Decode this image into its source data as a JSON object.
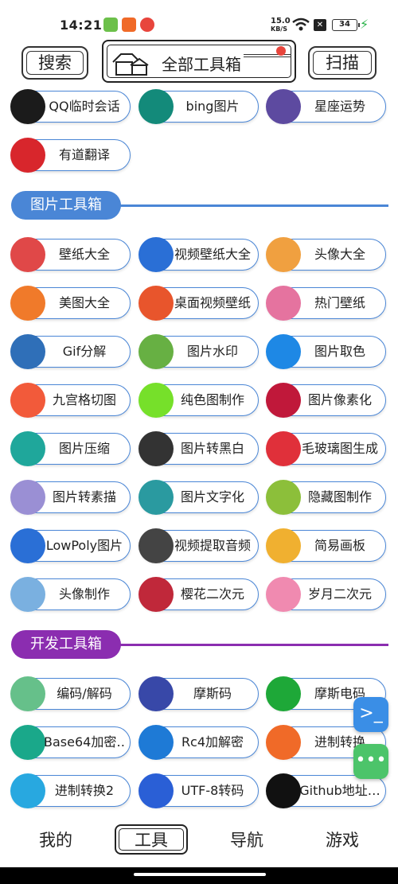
{
  "status": {
    "time": "14:21",
    "net_speed": "15.0",
    "net_unit": "KB/S",
    "battery": "34"
  },
  "header": {
    "search": "搜索",
    "title": "全部工具箱",
    "scan": "扫描"
  },
  "top_items": [
    {
      "label": "QQ临时会话",
      "icon": "qq-icon",
      "color": "#1b1b1b"
    },
    {
      "label": "bing图片",
      "icon": "bing-icon",
      "color": "#138a7a"
    },
    {
      "label": "星座运势",
      "icon": "constellation-icon",
      "color": "#5d4aa0"
    },
    {
      "label": "有道翻译",
      "icon": "youdao-icon",
      "color": "#d8262c"
    }
  ],
  "sections": [
    {
      "title": "图片工具箱",
      "color": "#4a86d6",
      "items": [
        {
          "label": "壁纸大全",
          "icon": "wallpaper-icon",
          "color": "#e04848"
        },
        {
          "label": "视频壁纸大全",
          "icon": "video-wallpaper-icon",
          "color": "#2a6fd6"
        },
        {
          "label": "头像大全",
          "icon": "avatar-gallery-icon",
          "color": "#f0a040"
        },
        {
          "label": "美图大全",
          "icon": "photos-icon",
          "color": "#f07a2a"
        },
        {
          "label": "桌面视频壁纸",
          "icon": "desktop-video-icon",
          "color": "#e8552c"
        },
        {
          "label": "热门壁纸",
          "icon": "dribbble-icon",
          "color": "#e5739f"
        },
        {
          "label": "Gif分解",
          "icon": "gif-icon",
          "color": "#2f6fb8"
        },
        {
          "label": "图片水印",
          "icon": "watermark-icon",
          "color": "#67b043"
        },
        {
          "label": "图片取色",
          "icon": "color-picker-icon",
          "color": "#1e88e5"
        },
        {
          "label": "九宫格切图",
          "icon": "grid-cut-icon",
          "color": "#f25a3a"
        },
        {
          "label": "纯色图制作",
          "icon": "solid-color-icon",
          "color": "#76e02a"
        },
        {
          "label": "图片像素化",
          "icon": "pixel-heart-icon",
          "color": "#c0183a"
        },
        {
          "label": "图片压缩",
          "icon": "compress-icon",
          "color": "#1fa79b"
        },
        {
          "label": "图片转黑白",
          "icon": "cloud-icon",
          "color": "#333333"
        },
        {
          "label": "毛玻璃图生成",
          "icon": "frosted-glass-icon",
          "color": "#e0303a"
        },
        {
          "label": "图片转素描",
          "icon": "sketch-icon",
          "color": "#9a8fd4"
        },
        {
          "label": "图片文字化",
          "icon": "text-image-icon",
          "color": "#2a9aa0"
        },
        {
          "label": "隐藏图制作",
          "icon": "hidden-image-icon",
          "color": "#8cbf3a"
        },
        {
          "label": "LowPoly图片",
          "icon": "lowpoly-icon",
          "color": "#2a6fd6"
        },
        {
          "label": "视频提取音频",
          "icon": "audio-wave-icon",
          "color": "#444444"
        },
        {
          "label": "简易画板",
          "icon": "palette-icon",
          "color": "#f0b030"
        },
        {
          "label": "头像制作",
          "icon": "avatar-maker-icon",
          "color": "#7ab0e0"
        },
        {
          "label": "樱花二次元",
          "icon": "anime-icon",
          "color": "#c0283a"
        },
        {
          "label": "岁月二次元",
          "icon": "bilibili-icon",
          "color": "#f08ab0"
        }
      ]
    },
    {
      "title": "开发工具箱",
      "color": "#8b2db0",
      "items": [
        {
          "label": "编码/解码",
          "icon": "code-icon",
          "color": "#66c08a"
        },
        {
          "label": "摩斯码",
          "icon": "morse-icon",
          "color": "#3848a8"
        },
        {
          "label": "摩斯电码",
          "icon": "morse-telegraph-icon",
          "color": "#1ea838"
        },
        {
          "label": "Base64加密…",
          "icon": "lock-icon",
          "color": "#1aa88a"
        },
        {
          "label": "Rc4加解密",
          "icon": "padlock-icon",
          "color": "#1e7ad6"
        },
        {
          "label": "进制转换",
          "icon": "refresh-icon",
          "color": "#f06a28"
        },
        {
          "label": "进制转换2",
          "icon": "sync-icon",
          "color": "#28a8e0"
        },
        {
          "label": "UTF-8转码",
          "icon": "convert-icon",
          "color": "#2a5fd6"
        },
        {
          "label": "Github地址…",
          "icon": "github-icon",
          "color": "#111111"
        }
      ]
    }
  ],
  "floating": {
    "terminal": "terminal-icon",
    "more": "more-icon"
  },
  "tabs": [
    "我的",
    "工具",
    "导航",
    "游戏"
  ]
}
